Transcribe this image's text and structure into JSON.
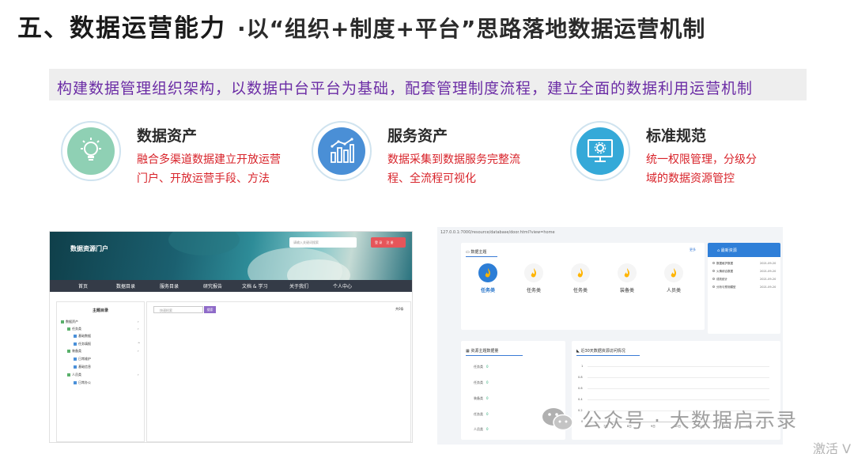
{
  "slide": {
    "title_main": "五、数据运营能力",
    "title_sub": "·以“组织+制度+平台”思路落地数据运营机制",
    "subtitle": "构建数据管理组织架构，以数据中台平台为基础，配套管理制度流程，建立全面的数据利用运营机制"
  },
  "features": [
    {
      "title": "数据资产",
      "desc_line1": "融合多渠道数据建立开放运营",
      "desc_line2": "门户、开放运营手段、方法",
      "icon": "lightbulb-icon",
      "color": "#8fd0b4"
    },
    {
      "title": "服务资产",
      "desc_line1": "数据采集到数据服务完整流",
      "desc_line2": "程、全流程可视化",
      "icon": "bar-chart-icon",
      "color": "#4a8fd6"
    },
    {
      "title": "标准规范",
      "desc_line1": "统一权限管理，分级分",
      "desc_line2": "域的数据资源管控",
      "icon": "monitor-gear-icon",
      "color": "#35a9d8"
    }
  ],
  "portal": {
    "title": "数据资源门户",
    "search_placeholder": "请输入关键词搜索",
    "login_buttons": "登 录    注 册",
    "nav": [
      "首页",
      "数据目录",
      "服务目录",
      "研究报告",
      "文档 & 学习",
      "关于我们",
      "个人中心"
    ],
    "sidebar_title": "主题目录",
    "tree": [
      "数据资产",
      "任务类",
      "基础数据",
      "任务填报",
      "装备类",
      "日常维护",
      "基础信息",
      "人员类",
      "日常办公"
    ],
    "main_search_placeholder": "快速检索",
    "main_search_btn": "搜索",
    "result_count": "共0条"
  },
  "dashboard": {
    "url": "127.0.0.1:7000/resource/database/door.html?view=home",
    "themes_title": "数据主题",
    "more": "更多",
    "themes": [
      "任务类",
      "任务类",
      "任务类",
      "装备类",
      "人员类"
    ],
    "latest_title": "最新资源",
    "latest": [
      {
        "name": "数据维护数据",
        "date": "2021-09-20"
      },
      {
        "name": "火情综合数据",
        "date": "2021-09-20"
      },
      {
        "name": "成效统计",
        "date": "2021-09-20"
      },
      {
        "name": "分析与预测模型",
        "date": "2021-09-20"
      }
    ],
    "stats_title": "资源主题数据量",
    "stats": [
      {
        "label": "任务类",
        "value": "0"
      },
      {
        "label": "任务类",
        "value": "0"
      },
      {
        "label": "装备类",
        "value": "0"
      },
      {
        "label": "任务类",
        "value": "0"
      },
      {
        "label": "人员类",
        "value": "0"
      }
    ],
    "trend_title": "近30天数据资源访问情况",
    "yticks": [
      "1",
      "0.8",
      "0.6",
      "0.4",
      "0.2",
      "0"
    ],
    "xticks": [
      "7日",
      "8日",
      "9日",
      "10日",
      "11日",
      "12日",
      "13日"
    ]
  },
  "watermark": {
    "text": "公众号 · 大数据启示录",
    "activate": "激活 V"
  }
}
